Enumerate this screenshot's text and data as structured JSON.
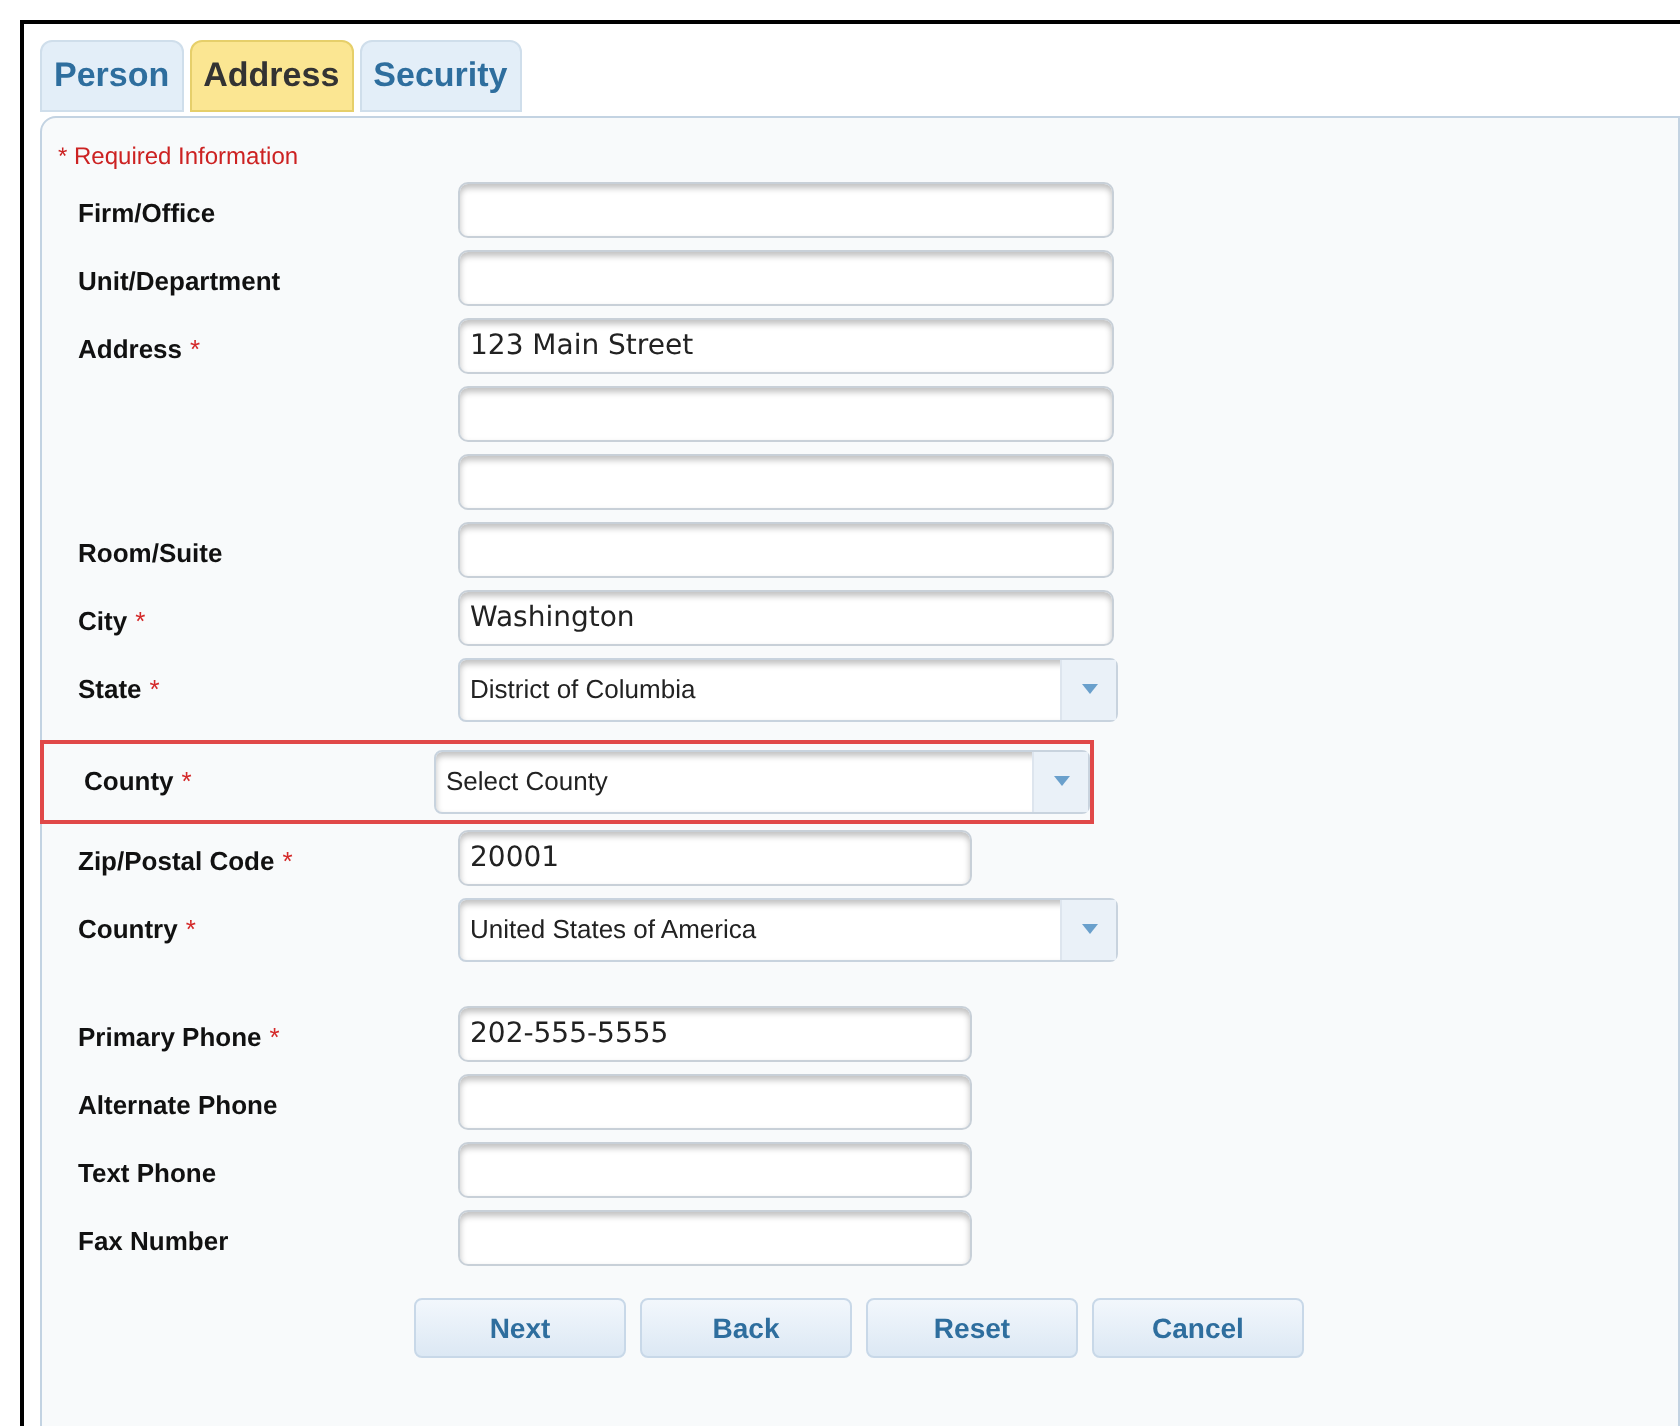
{
  "tabs": [
    {
      "label": "Person",
      "selected": false
    },
    {
      "label": "Address",
      "selected": true
    },
    {
      "label": "Security",
      "selected": false
    }
  ],
  "required_note": "* Required Information",
  "sections": [
    {
      "rows": [
        {
          "label": "Firm/Office",
          "kind": "text",
          "value": ""
        },
        {
          "label": "Unit/Department",
          "kind": "text",
          "value": ""
        },
        {
          "label": "Address",
          "mark": "*",
          "kind": "text",
          "value": "123 Main Street"
        },
        {
          "kind": "text",
          "value": ""
        },
        {
          "kind": "text",
          "value": ""
        },
        {
          "label": "Room/Suite",
          "kind": "text",
          "value": ""
        },
        {
          "label": "City",
          "mark": "*",
          "kind": "text",
          "value": "Washington"
        },
        {
          "label": "State",
          "mark": "*",
          "kind": "select",
          "value": "District of Columbia"
        },
        {
          "label": "County",
          "mark": "*",
          "kind": "select",
          "value": "Select County",
          "highlighted": true
        },
        {
          "label": "Zip/Postal Code",
          "mark": "*",
          "kind": "short",
          "value": "20001"
        },
        {
          "label": "Country",
          "mark": "*",
          "kind": "select",
          "value": "United States of America"
        }
      ]
    },
    {
      "rows": [
        {
          "label": "Primary Phone",
          "mark": "*",
          "kind": "short",
          "value": "202-555-5555"
        },
        {
          "label": "Alternate Phone",
          "kind": "short",
          "value": ""
        },
        {
          "label": "Text Phone",
          "kind": "short",
          "value": ""
        },
        {
          "label": "Fax Number",
          "kind": "short",
          "value": ""
        }
      ]
    }
  ],
  "buttons": [
    "Next",
    "Back",
    "Reset",
    "Cancel"
  ]
}
